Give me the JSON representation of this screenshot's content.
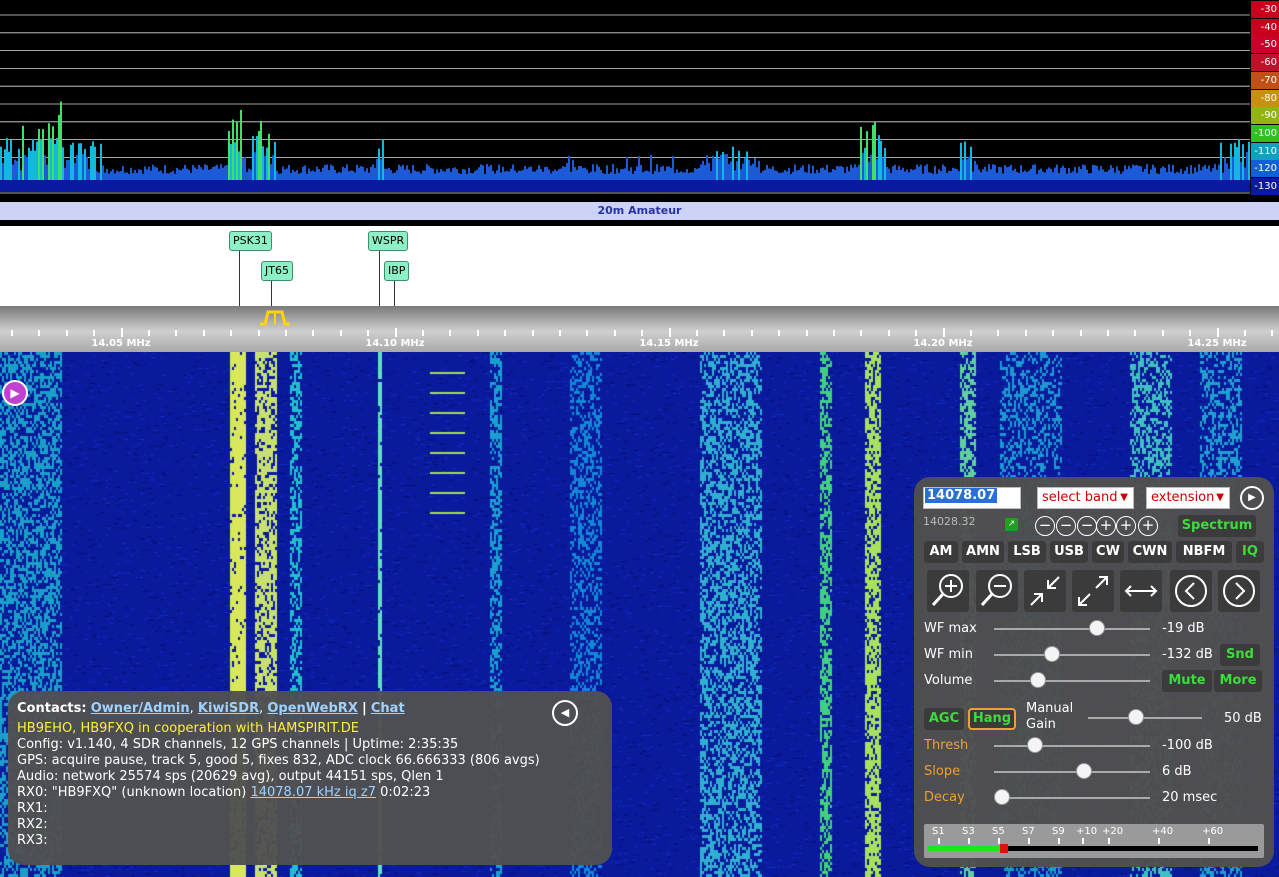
{
  "spectrum": {
    "db_scale": [
      {
        "label": "-30",
        "color": "#c8001e"
      },
      {
        "label": "-40",
        "color": "#c8001e"
      },
      {
        "label": "-50",
        "color": "#c8002a"
      },
      {
        "label": "-60",
        "color": "#c0102a"
      },
      {
        "label": "-70",
        "color": "#c05018"
      },
      {
        "label": "-80",
        "color": "#c89010"
      },
      {
        "label": "-90",
        "color": "#90b410"
      },
      {
        "label": "-100",
        "color": "#30c020"
      },
      {
        "label": "-110",
        "color": "#10a0c0"
      },
      {
        "label": "-120",
        "color": "#1060d8"
      },
      {
        "label": "-130",
        "color": "#0a1aa0"
      }
    ]
  },
  "band_bar": {
    "label": "20m Amateur"
  },
  "dx_labels": [
    {
      "name": "PSK31"
    },
    {
      "name": "JT65"
    },
    {
      "name": "WSPR"
    },
    {
      "name": "IBP"
    }
  ],
  "scale": {
    "mhz_labels": [
      "14.05 MHz",
      "14.10 MHz",
      "14.15 MHz",
      "14.20 MHz",
      "14.25 MHz"
    ]
  },
  "info": {
    "contacts_label": "Contacts:",
    "links": [
      "Owner/Admin",
      "KiwiSDR",
      "OpenWebRX"
    ],
    "chat_link": "Chat",
    "separator": ",",
    "pipe": "|",
    "owner_line": "HB9EHO, HB9FXQ in cooperation with HAMSPIRIT.DE",
    "config_line": "Config: v1.140, 4 SDR channels, 12 GPS channels | Uptime: 2:35:35",
    "gps_line": "GPS: acquire pause, track 5, good 5, fixes 832, ADC clock 66.666333 (806 avgs)",
    "audio_line": "Audio: network 25574 sps (20629 avg), output 44151 sps, Qlen 1",
    "rx0_prefix": "RX0: \"HB9FXQ\" (unknown location)",
    "rx0_link": "14078.07 kHz iq z7",
    "rx0_suffix": "0:02:23",
    "rx1": "RX1:",
    "rx2": "RX2:",
    "rx3": "RX3:"
  },
  "control": {
    "frequency": "14078.07",
    "select_band": "select band",
    "extension": "extension",
    "freq_sub": "14028.32",
    "spectrum_btn": "Spectrum",
    "modes": [
      "AM",
      "AMN",
      "LSB",
      "USB",
      "CW",
      "CWN",
      "NBFM"
    ],
    "iq_btn": "IQ",
    "wf_max": {
      "label": "WF max",
      "value": "-19 dB",
      "level": 0.66
    },
    "wf_min": {
      "label": "WF min",
      "value": "-132 dB",
      "level": 0.37
    },
    "volume": {
      "label": "Volume",
      "value_level": 0.28
    },
    "snd_btn": "Snd",
    "mute_btn": "Mute",
    "more_btn": "More",
    "agc_btn": "AGC",
    "hang_btn": "Hang",
    "manual_gain": "Manual Gain",
    "manual_gain_line1": "Manual",
    "manual_gain_line2": "Gain",
    "gain": {
      "value": "50 dB",
      "level": 0.42
    },
    "thresh": {
      "label": "Thresh",
      "value": "-100 dB",
      "level": 0.26
    },
    "slope": {
      "label": "Slope",
      "value": "6 dB",
      "level": 0.58
    },
    "decay": {
      "label": "Decay",
      "value": "20 msec",
      "level": 0.05
    },
    "smeter_labels": [
      "S1",
      "S3",
      "S5",
      "S7",
      "S9",
      "+10",
      "+20",
      "+40",
      "+60"
    ],
    "smeter_level": "S5"
  }
}
